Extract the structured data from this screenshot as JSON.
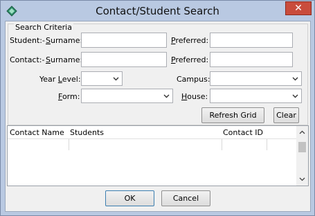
{
  "window": {
    "title": "Contact/Student Search"
  },
  "search_criteria": {
    "legend": "Search Criteria",
    "student_prefix": "Student:-",
    "contact_prefix": "Contact:-",
    "surname_label_u": "S",
    "surname_label_rest": "urname:",
    "preferred_label_u": "P",
    "preferred_label_rest": "referred:",
    "student_surname_value": "",
    "student_preferred_value": "",
    "contact_surname_value": "",
    "contact_preferred_value": "",
    "year_level_label_a": "Year ",
    "year_level_label_u": "L",
    "year_level_label_b": "evel:",
    "year_level_value": "",
    "campus_label": "Campus:",
    "campus_value": "",
    "form_label_u": "F",
    "form_label_rest": "orm:",
    "form_value": "",
    "house_label_u": "H",
    "house_label_rest": "ouse:",
    "house_value": "",
    "refresh_label": "Refresh Grid",
    "clear_label": "Clear"
  },
  "grid": {
    "columns": [
      "Contact Name",
      "Students",
      "Contact ID"
    ]
  },
  "footer": {
    "ok_label": "OK",
    "cancel_label": "Cancel"
  },
  "icons": {
    "app": "app-diamond-icon",
    "close": "close-icon",
    "dropdown": "chevron-down-icon"
  },
  "colors": {
    "close_button": "#c94c3c",
    "window_frame": "#b9c9e2"
  }
}
